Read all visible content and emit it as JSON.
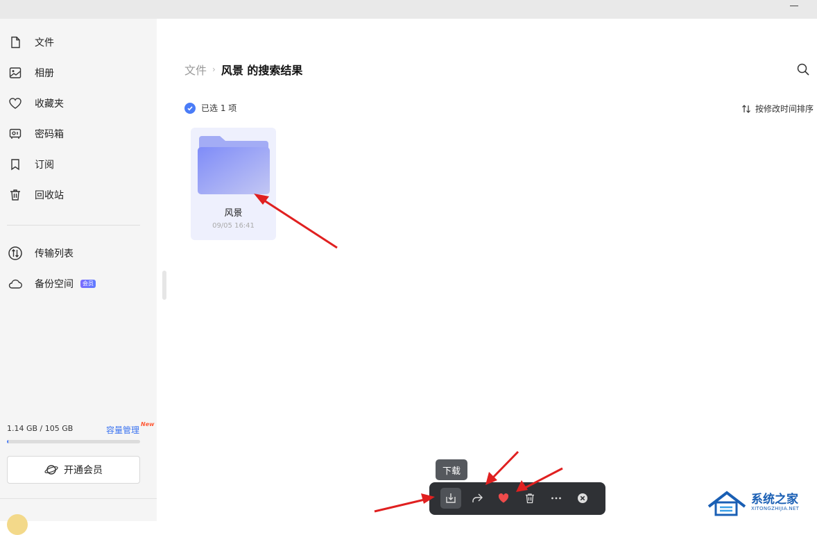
{
  "sidebar": {
    "items": [
      {
        "label": "文件",
        "icon": "file-icon"
      },
      {
        "label": "相册",
        "icon": "photo-album-icon"
      },
      {
        "label": "收藏夹",
        "icon": "heart-icon"
      },
      {
        "label": "密码箱",
        "icon": "safe-box-icon"
      },
      {
        "label": "订阅",
        "icon": "bookmark-icon"
      },
      {
        "label": "回收站",
        "icon": "trash-icon"
      },
      {
        "label": "传输列表",
        "icon": "transfer-icon"
      },
      {
        "label": "备份空间",
        "icon": "cloud-icon",
        "badge": "会员"
      }
    ],
    "storage": {
      "text": "1.14 GB / 105 GB",
      "used_fraction": 0.011,
      "manage_label": "容量管理",
      "new_tag": "New"
    },
    "vip_button": "开通会员"
  },
  "main": {
    "breadcrumb": {
      "root": "文件",
      "separator": "›",
      "current": "风景 的搜索结果"
    },
    "selection_text": "已选 1 项",
    "sort_label": "按修改时间排序",
    "files": [
      {
        "name": "风景",
        "date": "09/05 16:41",
        "type": "folder",
        "selected": true
      }
    ]
  },
  "toolbar": {
    "tooltip": "下载",
    "buttons": [
      "download",
      "share",
      "favorite",
      "delete",
      "more",
      "close"
    ]
  },
  "watermark": {
    "title": "系统之家",
    "subtitle": "XITONGZHIJIA.NET"
  },
  "colors": {
    "accent": "#4a7cf7",
    "toolbar_bg": "#2f3135",
    "favorite": "#ee4b4b",
    "arrow": "#e02020"
  }
}
